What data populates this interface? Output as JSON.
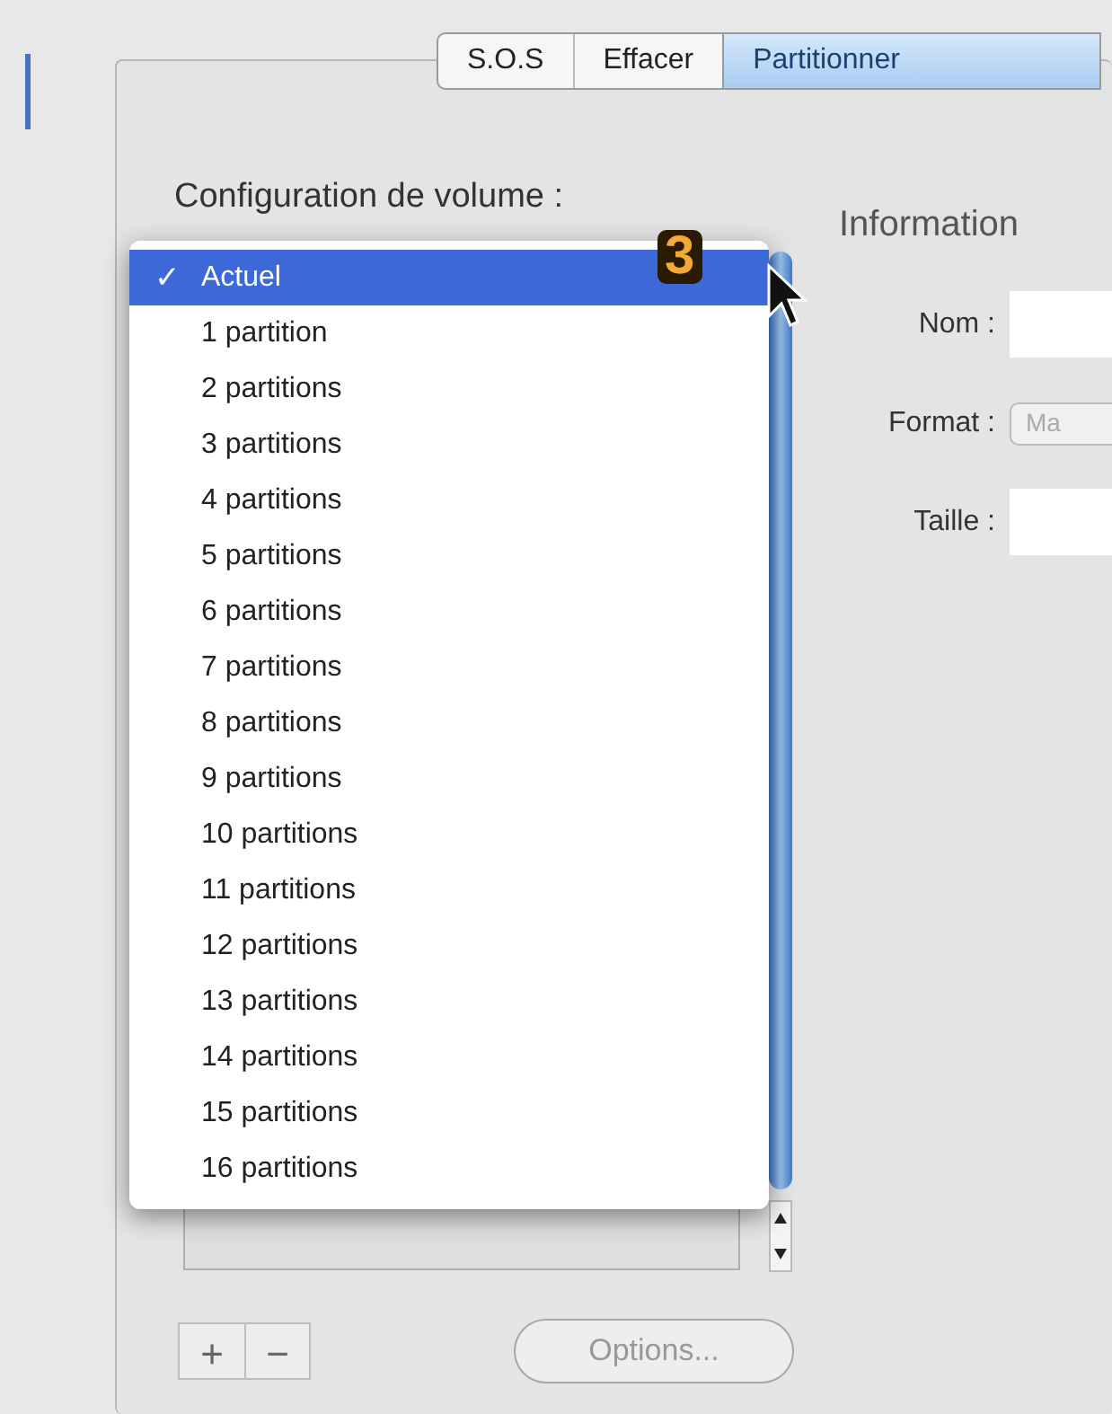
{
  "tabs": [
    {
      "label": "S.O.S",
      "selected": false
    },
    {
      "label": "Effacer",
      "selected": false
    },
    {
      "label": "Partitionner",
      "selected": true
    }
  ],
  "volume_config": {
    "label": "Configuration de volume :"
  },
  "dropdown_menu": {
    "items": [
      {
        "label": "Actuel",
        "selected": true
      },
      {
        "label": "1 partition",
        "selected": false
      },
      {
        "label": "2 partitions",
        "selected": false
      },
      {
        "label": "3 partitions",
        "selected": false
      },
      {
        "label": "4 partitions",
        "selected": false
      },
      {
        "label": "5 partitions",
        "selected": false
      },
      {
        "label": "6 partitions",
        "selected": false
      },
      {
        "label": "7 partitions",
        "selected": false
      },
      {
        "label": "8 partitions",
        "selected": false
      },
      {
        "label": "9 partitions",
        "selected": false
      },
      {
        "label": "10 partitions",
        "selected": false
      },
      {
        "label": "11 partitions",
        "selected": false
      },
      {
        "label": "12 partitions",
        "selected": false
      },
      {
        "label": "13 partitions",
        "selected": false
      },
      {
        "label": "14 partitions",
        "selected": false
      },
      {
        "label": "15 partitions",
        "selected": false
      },
      {
        "label": "16 partitions",
        "selected": false
      }
    ]
  },
  "annotation": {
    "text": "3"
  },
  "check_mark": "✓",
  "buttons": {
    "add": "+",
    "remove": "−",
    "options": "Options..."
  },
  "information": {
    "title": "Information",
    "fields": [
      {
        "label": "Nom :",
        "kind": "text"
      },
      {
        "label": "Format :",
        "kind": "popup",
        "value": "Ma"
      },
      {
        "label": "Taille :",
        "kind": "text"
      }
    ]
  }
}
